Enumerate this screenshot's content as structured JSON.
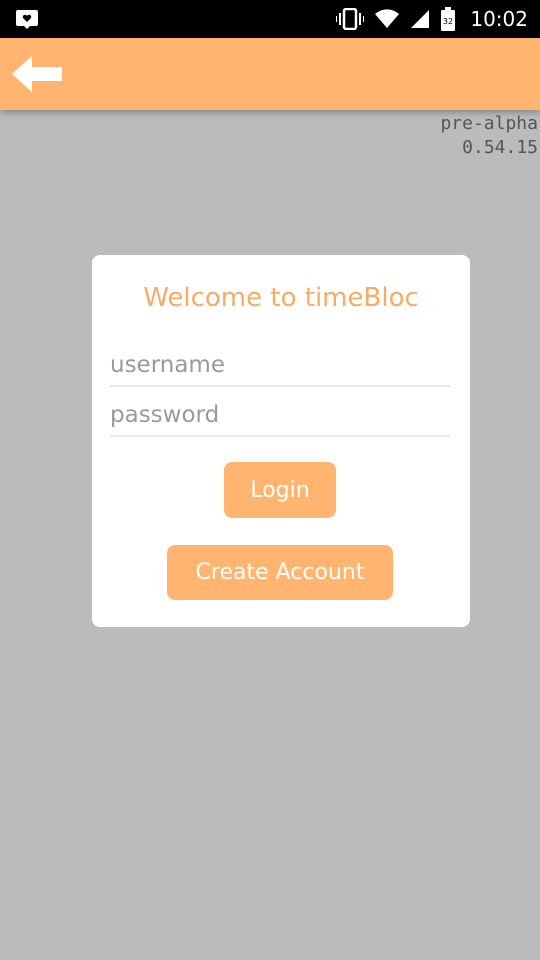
{
  "status_bar": {
    "time": "10:02",
    "battery_level": "32",
    "icons": [
      "notification-icon",
      "vibrate-icon",
      "wifi-icon",
      "signal-icon",
      "battery-icon"
    ]
  },
  "app_bar": {
    "color": "#ffb570",
    "back_icon": "arrow-left-icon"
  },
  "version": {
    "line1": "pre-alpha",
    "line2": "0.54.15"
  },
  "login_card": {
    "title": "Welcome to timeBloc",
    "username_placeholder": "username",
    "password_placeholder": "password",
    "login_label": "Login",
    "create_account_label": "Create Account"
  },
  "colors": {
    "accent": "#ffb570",
    "title_text": "#f5ad66",
    "background": "#bbbabd"
  }
}
